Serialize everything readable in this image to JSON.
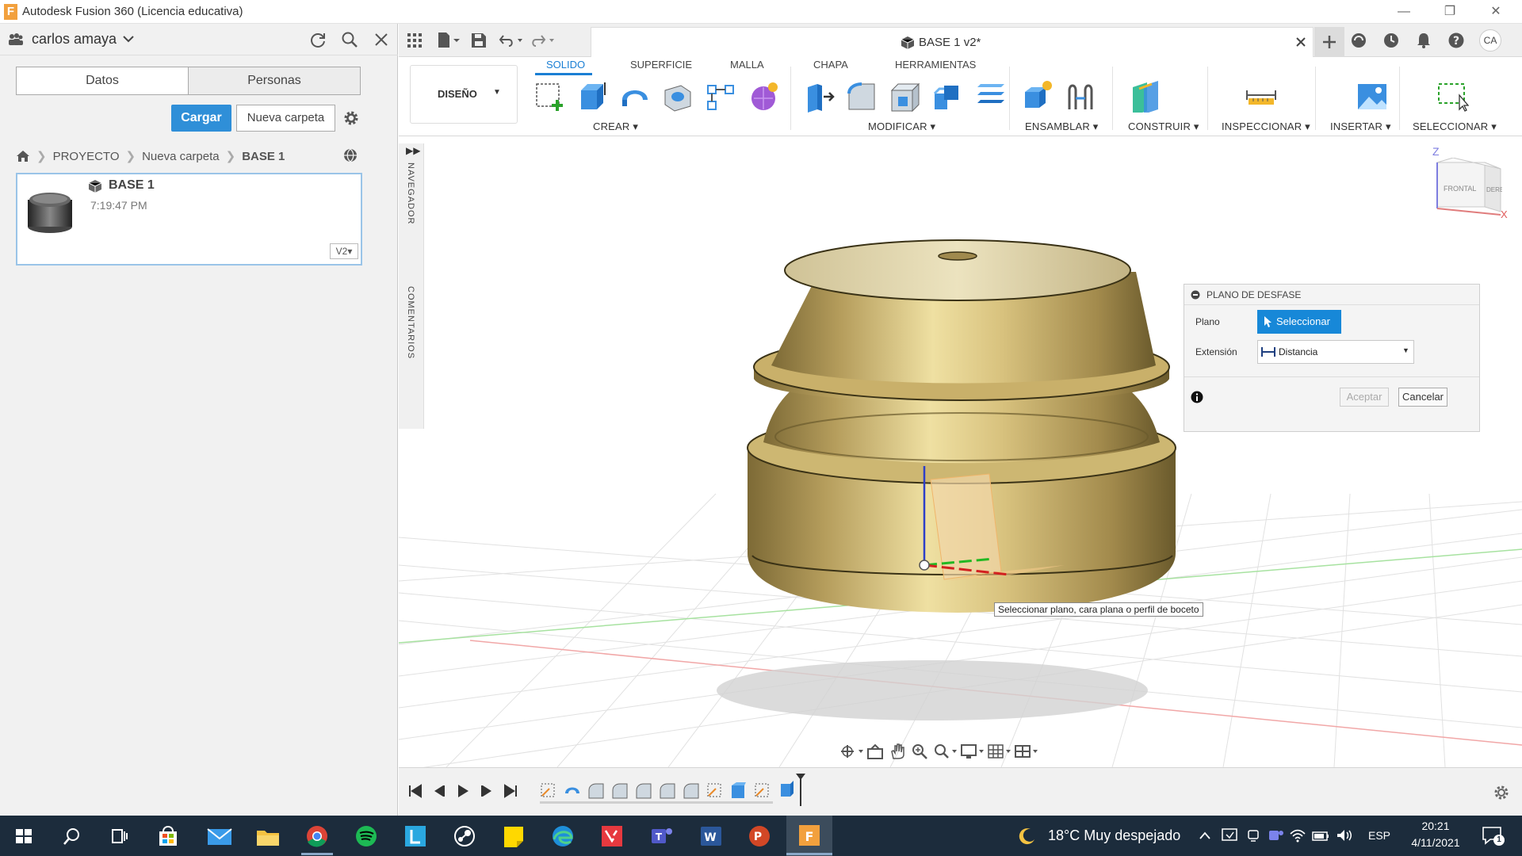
{
  "window": {
    "title": "Autodesk Fusion 360 (Licencia educativa)",
    "app_letter": "F"
  },
  "left_panel": {
    "user_name": "carlos amaya",
    "tabs": [
      "Datos",
      "Personas"
    ],
    "upload_button": "Cargar",
    "new_folder_button": "Nueva carpeta",
    "breadcrumb": [
      "PROYECTO",
      "Nueva carpeta",
      "BASE 1"
    ],
    "item": {
      "name": "BASE 1",
      "time": "7:19:47 PM",
      "version": "V2"
    }
  },
  "document": {
    "tab_title": "BASE 1 v2*",
    "user_initials": "CA"
  },
  "ribbon": {
    "workspace": "DISEÑO",
    "tabs": [
      "SOLIDO",
      "SUPERFICIE",
      "MALLA",
      "CHAPA",
      "HERRAMIENTAS"
    ],
    "active_tab": "SOLIDO",
    "groups": [
      "CREAR",
      "MODIFICAR",
      "ENSAMBLAR",
      "CONSTRUIR",
      "INSPECCIONAR",
      "INSERTAR",
      "SELECCIONAR"
    ]
  },
  "side_strip": {
    "navigator": "NAVEGADOR",
    "comments": "COMENTARIOS"
  },
  "viewcube": {
    "front": "FRONTAL",
    "right": "DERECHA",
    "z_axis": "Z",
    "x_axis": "X"
  },
  "dialog": {
    "title": "PLANO DE DESFASE",
    "plane_label": "Plano",
    "select_button": "Seleccionar",
    "extent_label": "Extensión",
    "extent_value": "Distancia",
    "ok": "Aceptar",
    "cancel": "Cancelar"
  },
  "tooltip": "Seleccionar plano, cara plana o perfil de boceto",
  "taskbar": {
    "weather": "18°C  Muy despejado",
    "language": "ESP",
    "time": "20:21",
    "date": "4/11/2021",
    "notifications": "1"
  },
  "colors": {
    "accent_blue": "#2f8fd8",
    "select_blue": "#1788d8",
    "gold": "#c9b06a",
    "taskbar": "#1c2c3c"
  }
}
